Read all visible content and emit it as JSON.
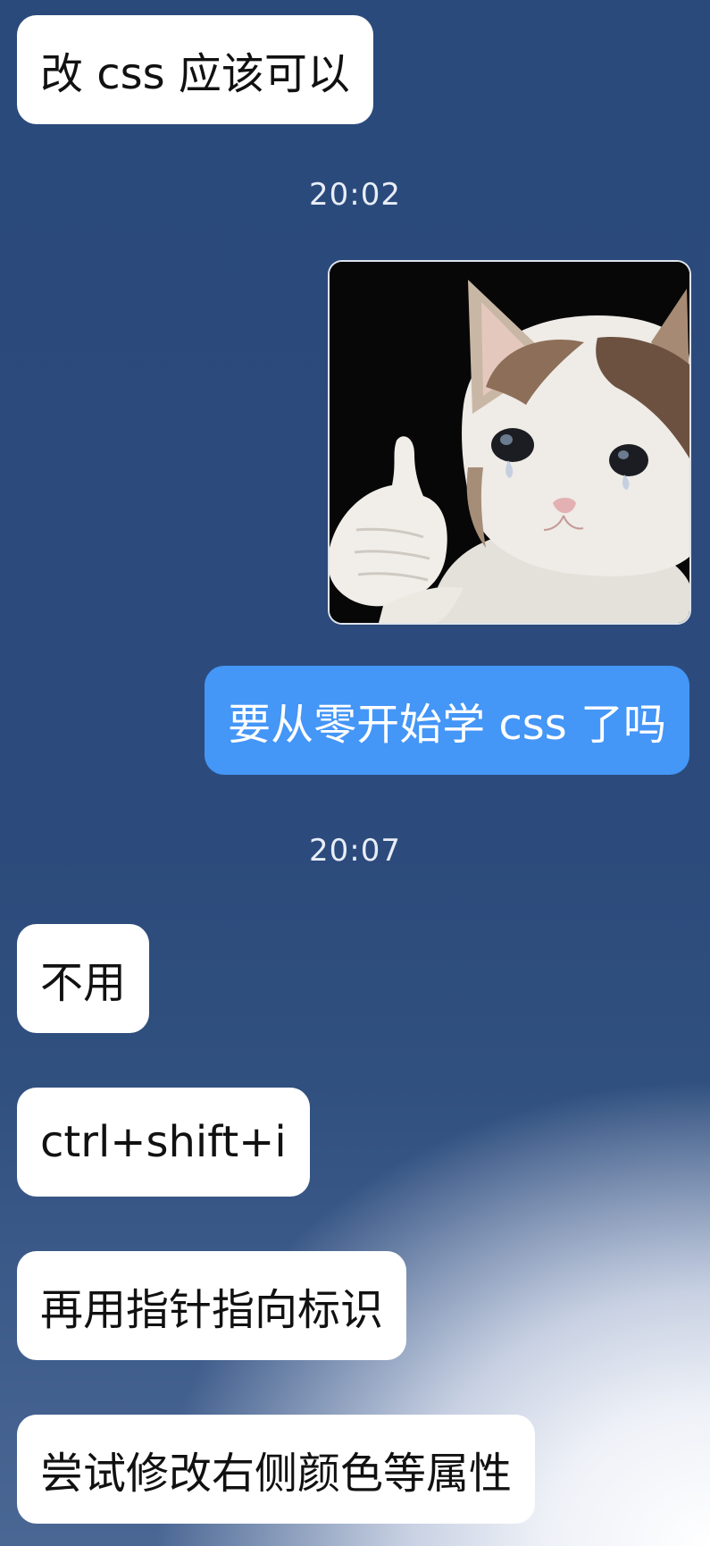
{
  "messages": [
    {
      "side": "left",
      "text": "改 css 应该可以"
    },
    {
      "side": "right",
      "type": "image",
      "icon": "crying-cat-thumbs-up-sticker"
    },
    {
      "side": "right",
      "text": "要从零开始学 css 了吗"
    },
    {
      "side": "left",
      "text": "不用"
    },
    {
      "side": "left",
      "text": "ctrl+shift+i"
    },
    {
      "side": "left",
      "text": "再用指针指向标识"
    },
    {
      "side": "left",
      "text": "尝试修改右侧颜色等属性"
    }
  ],
  "timestamps": [
    "20:02",
    "20:07"
  ],
  "colors": {
    "background": "#2b4a7c",
    "received_bubble": "#ffffff",
    "sent_bubble": "#4496f7",
    "timestamp_text": "#e8edf6"
  }
}
